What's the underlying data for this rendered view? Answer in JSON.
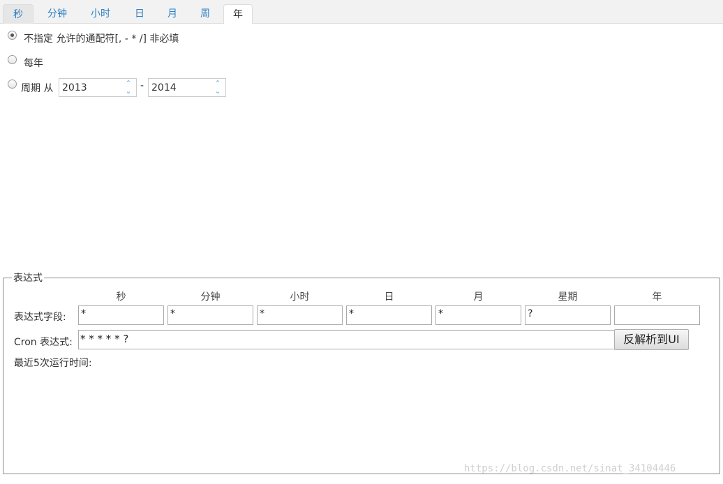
{
  "tabs": [
    "秒",
    "分钟",
    "小时",
    "日",
    "月",
    "周",
    "年"
  ],
  "active_tab": "年",
  "options": {
    "unspecified_label": "不指定 允许的通配符[, - * /] 非必填",
    "every_year_label": "每年",
    "period_label": "周期 从",
    "period_from": "2013",
    "period_separator": "-",
    "period_to": "2014",
    "spinner_up": "⌃",
    "spinner_down": "⌄"
  },
  "expression": {
    "legend": "表达式",
    "columns": [
      "秒",
      "分钟",
      "小时",
      "日",
      "月",
      "星期",
      "年"
    ],
    "field_label": "表达式字段:",
    "field_values": [
      "*",
      "*",
      "*",
      "*",
      "*",
      "?",
      ""
    ],
    "cron_label": "Cron 表达式:",
    "cron_value": "* * * * * ?",
    "parse_button": "反解析到UI",
    "recent_label": "最近5次运行时间:"
  },
  "watermark": "https://blog.csdn.net/sinat_34104446"
}
